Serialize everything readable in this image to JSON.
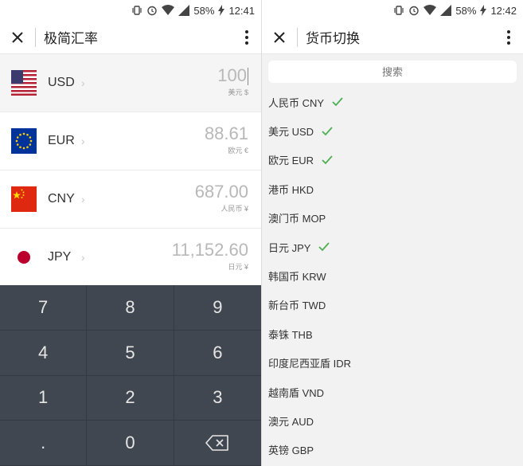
{
  "status_bar": {
    "battery": "58%",
    "time_left": "12:41",
    "time_right": "12:42"
  },
  "left": {
    "title": "极简汇率",
    "rates": [
      {
        "code": "USD",
        "amount": "100",
        "unit": "美元 $",
        "flag": "us-flag"
      },
      {
        "code": "EUR",
        "amount": "88.61",
        "unit": "欧元 €",
        "flag": "eu-flag"
      },
      {
        "code": "CNY",
        "amount": "687.00",
        "unit": "人民币 ¥",
        "flag": "cn-flag"
      },
      {
        "code": "JPY",
        "amount": "11,152.60",
        "unit": "日元 ¥",
        "flag": "jp-flag"
      }
    ],
    "keypad": [
      "7",
      "8",
      "9",
      "4",
      "5",
      "6",
      "1",
      "2",
      "3",
      ".",
      "0",
      "backspace"
    ]
  },
  "right": {
    "title": "货币切换",
    "search_placeholder": "搜索",
    "currencies": [
      {
        "label": "人民币 CNY",
        "selected": true
      },
      {
        "label": "美元 USD",
        "selected": true
      },
      {
        "label": "欧元 EUR",
        "selected": true
      },
      {
        "label": "港币 HKD",
        "selected": false
      },
      {
        "label": "澳门币 MOP",
        "selected": false
      },
      {
        "label": "日元 JPY",
        "selected": true
      },
      {
        "label": "韩国币 KRW",
        "selected": false
      },
      {
        "label": "新台币 TWD",
        "selected": false
      },
      {
        "label": "泰铢 THB",
        "selected": false
      },
      {
        "label": "印度尼西亚盾 IDR",
        "selected": false
      },
      {
        "label": "越南盾 VND",
        "selected": false
      },
      {
        "label": "澳元 AUD",
        "selected": false
      },
      {
        "label": "英镑 GBP",
        "selected": false
      }
    ]
  },
  "colors": {
    "check": "#4caf50",
    "keypad_bg": "#414750"
  }
}
